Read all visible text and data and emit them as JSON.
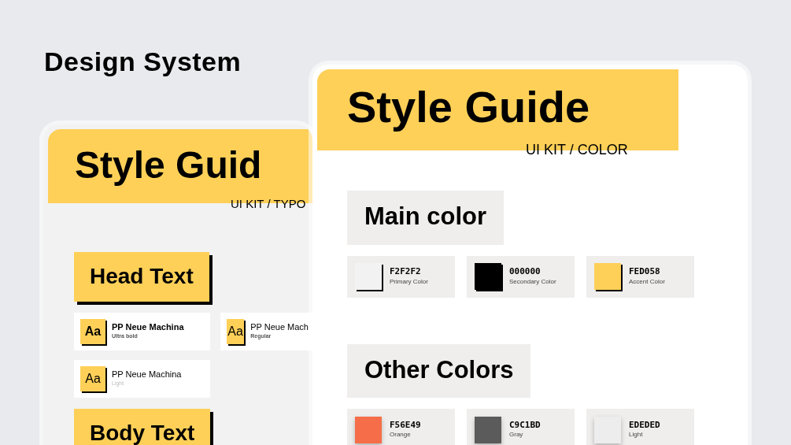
{
  "page_title": "Design System",
  "typography_board": {
    "title": "Style Guid",
    "subtitle": "UI KIT / TYPO",
    "sections": [
      {
        "heading": "Head Text",
        "fonts": [
          {
            "sample": "Aa",
            "name": "PP Neue Machina",
            "weight_label": "Ultra bold",
            "kind": "ultrabold"
          },
          {
            "sample": "Aa",
            "name": "PP Neue Mach",
            "weight_label": "Regular",
            "kind": "regular"
          },
          {
            "sample": "Aa",
            "name": "PP Neue Machina",
            "weight_label": "Light",
            "kind": "light"
          }
        ]
      },
      {
        "heading": "Body Text"
      }
    ]
  },
  "color_board": {
    "title": "Style Guide",
    "subtitle": "UI KIT / COLOR",
    "sections": [
      {
        "heading": "Main color",
        "kind": "hard",
        "swatches": [
          {
            "code": "F2F2F2",
            "label": "Primary Color",
            "color": "#f2f2f2"
          },
          {
            "code": "000000",
            "label": "Secondary Color",
            "color": "#000000"
          },
          {
            "code": "FED058",
            "label": "Accent Color",
            "color": "#fed058"
          }
        ]
      },
      {
        "heading": "Other Colors",
        "kind": "soft",
        "swatches": [
          {
            "code": "F56E49",
            "label": "Orange",
            "color": "#f56e49"
          },
          {
            "code": "C9C1BD",
            "label": "Gray",
            "color": "#5b5b5b"
          },
          {
            "code": "EDEDED",
            "label": "Light",
            "color": "#ededed"
          }
        ]
      }
    ]
  }
}
